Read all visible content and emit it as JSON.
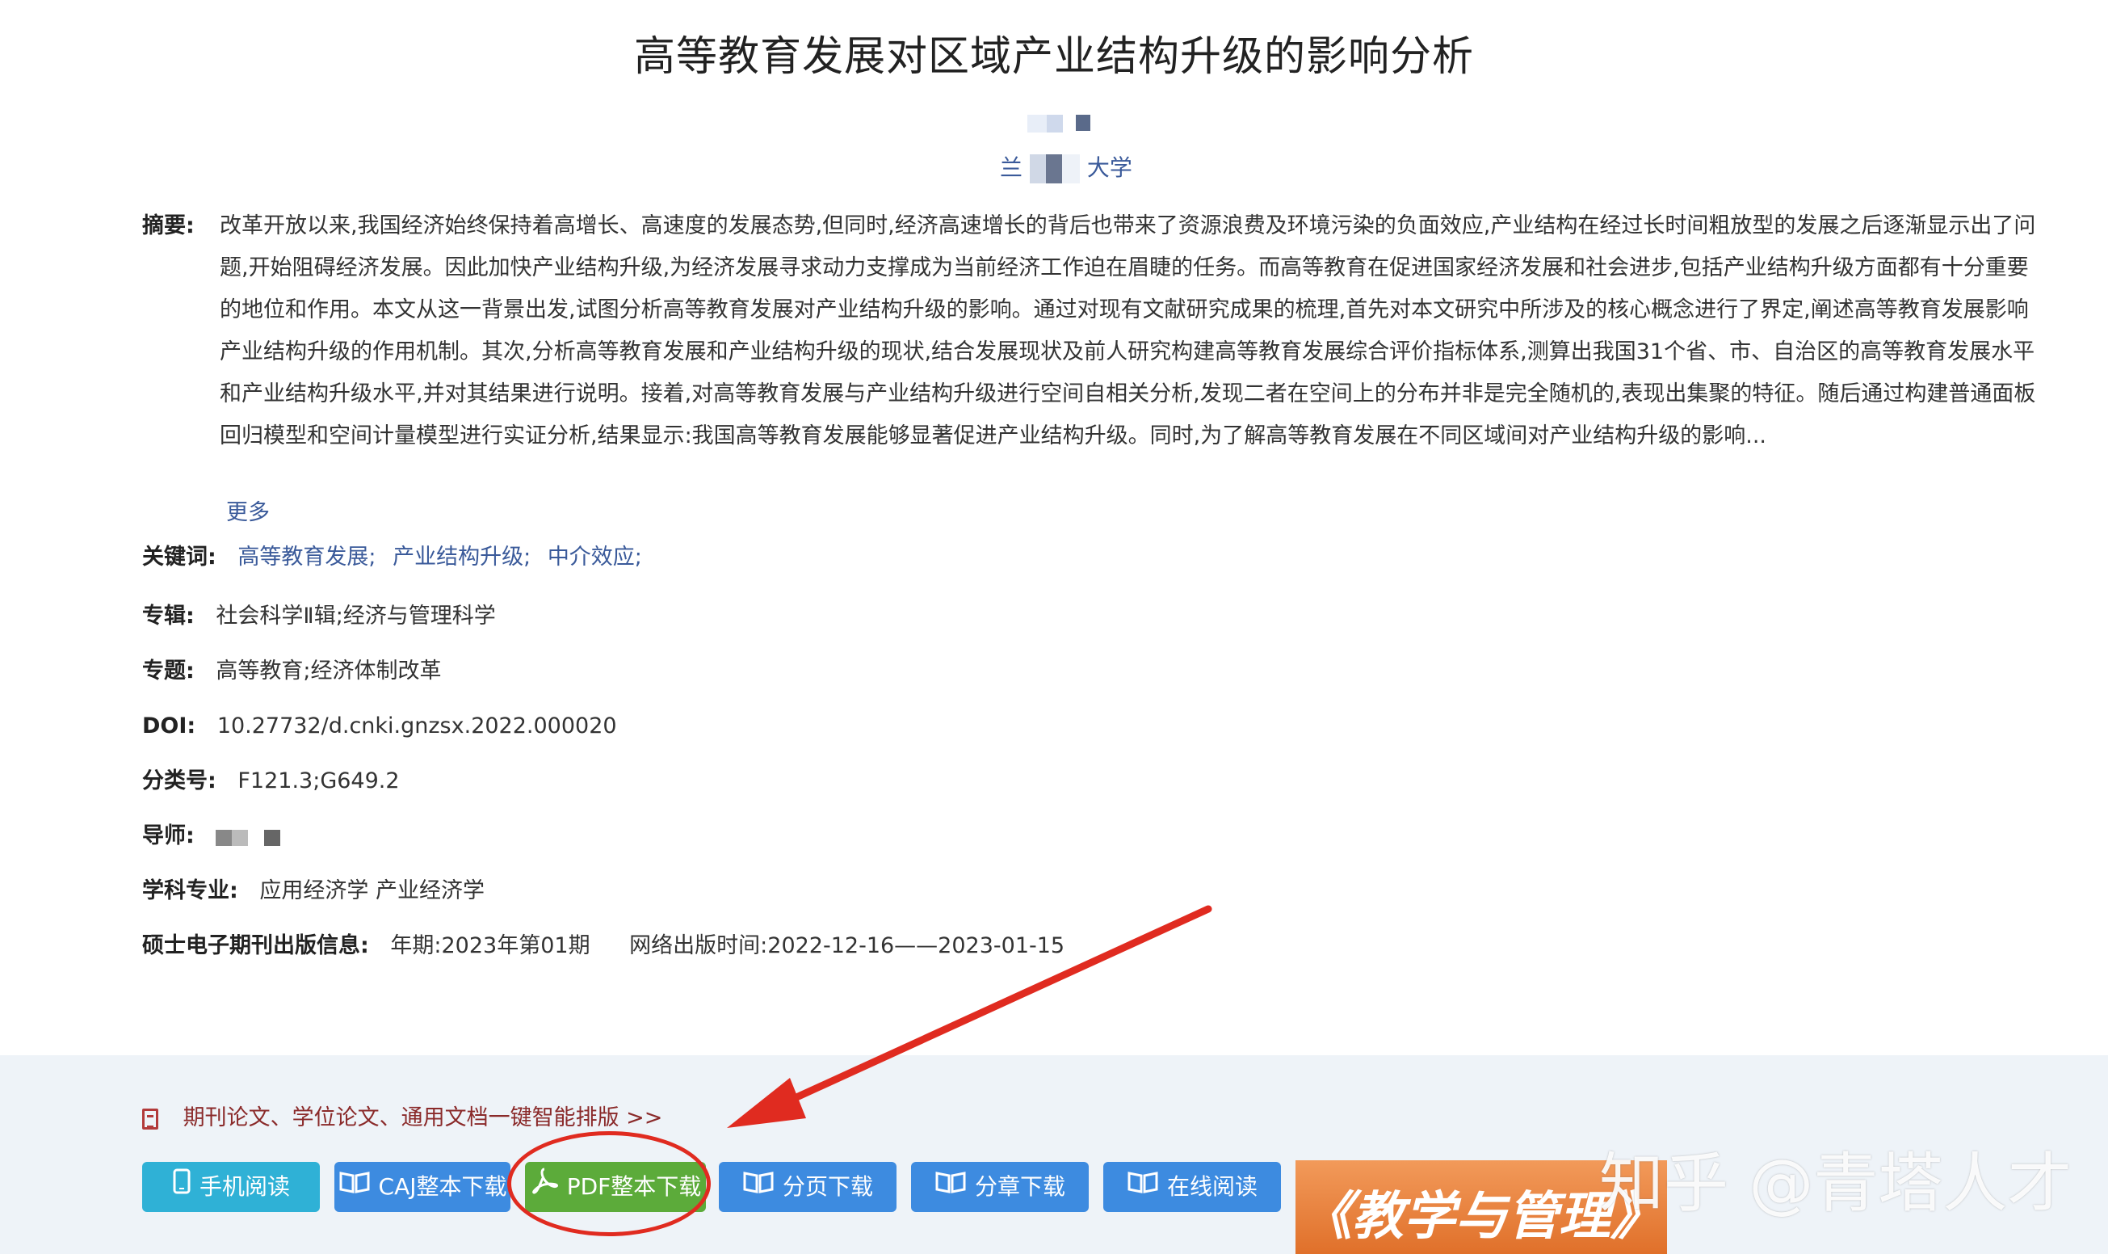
{
  "title": "高等教育发展对区域产业结构升级的影响分析",
  "affiliation": {
    "prefix": "兰",
    "suffix": "大学"
  },
  "abstract": {
    "label": "摘要:",
    "text": "改革开放以来,我国经济始终保持着高增长、高速度的发展态势,但同时,经济高速增长的背后也带来了资源浪费及环境污染的负面效应,产业结构在经过长时间粗放型的发展之后逐渐显示出了问题,开始阻碍经济发展。因此加快产业结构升级,为经济发展寻求动力支撑成为当前经济工作迫在眉睫的任务。而高等教育在促进国家经济发展和社会进步,包括产业结构升级方面都有十分重要的地位和作用。本文从这一背景出发,试图分析高等教育发展对产业结构升级的影响。通过对现有文献研究成果的梳理,首先对本文研究中所涉及的核心概念进行了界定,阐述高等教育发展影响产业结构升级的作用机制。其次,分析高等教育发展和产业结构升级的现状,结合发展现状及前人研究构建高等教育发展综合评价指标体系,测算出我国31个省、市、自治区的高等教育发展水平和产业结构升级水平,并对其结果进行说明。接着,对高等教育发展与产业结构升级进行空间自相关分析,发现二者在空间上的分布并非是完全随机的,表现出集聚的特征。随后通过构建普通面板回归模型和空间计量模型进行实证分析,结果显示:我国高等教育发展能够显著促进产业结构升级。同时,为了解高等教育发展在不同区域间对产业结构升级的影响...",
    "more": "更多"
  },
  "fields": {
    "keywords_label": "关键词:",
    "keywords": [
      "高等教育发展;",
      "产业结构升级;",
      "中介效应;"
    ],
    "series_label": "专辑:",
    "series": "社会科学Ⅱ辑;经济与管理科学",
    "topic_label": "专题:",
    "topic": "高等教育;经济体制改革",
    "doi_label": "DOI:",
    "doi": "10.27732/d.cnki.gnzsx.2022.000020",
    "class_label": "分类号:",
    "class": "F121.3;G649.2",
    "advisor_label": "导师:",
    "discipline_label": "学科专业:",
    "discipline": "应用经济学 产业经济学",
    "pubinfo_label": "硕士电子期刊出版信息:",
    "pub_year": "年期:2023年第01期",
    "pub_online": "网络出版时间:2022-12-16——2023-01-15"
  },
  "smart_link": "期刊论文、学位论文、通用文档一键智能排版 >>",
  "buttons": {
    "mobile": "手机阅读",
    "caj": "CAJ整本下载",
    "pdf": "PDF整本下载",
    "page": "分页下载",
    "chapter": "分章下载",
    "online": "在线阅读"
  },
  "banner_text": "《教学与管理》",
  "watermark": "知乎 @青塔人才",
  "colors": {
    "link": "#3a5a9a",
    "teal": "#2fb1d6",
    "blue": "#3d8be0",
    "green": "#5cab3a",
    "annotation": "#e02b20"
  }
}
